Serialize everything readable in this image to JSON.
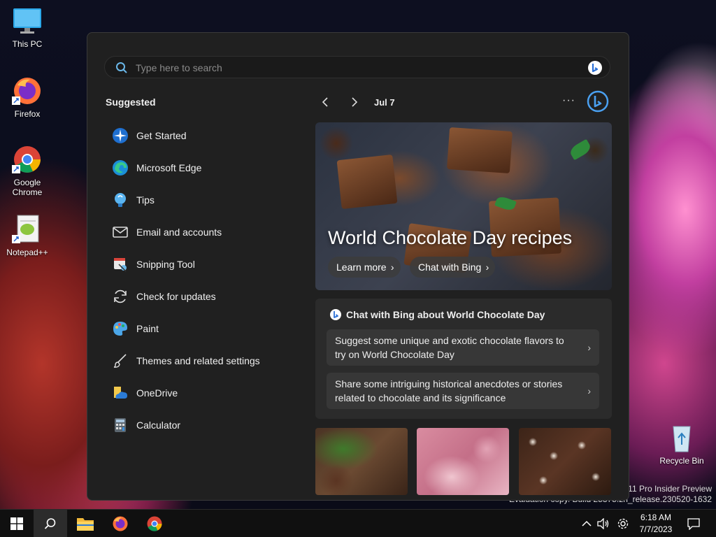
{
  "desktop": {
    "icons": [
      {
        "label": "This PC"
      },
      {
        "label": "Firefox"
      },
      {
        "label": "Google Chrome"
      },
      {
        "label": "Notepad++"
      },
      {
        "label": "Recycle Bin"
      }
    ],
    "watermark": {
      "line1": "s 11 Pro Insider Preview",
      "line2": "Evaluation copy. Build 25375.zn_release.230520-1632"
    }
  },
  "start_menu": {
    "search": {
      "placeholder": "Type here to search"
    },
    "suggested_title": "Suggested",
    "apps": [
      {
        "label": "Get Started",
        "icon": "get-started-icon"
      },
      {
        "label": "Microsoft Edge",
        "icon": "edge-icon"
      },
      {
        "label": "Tips",
        "icon": "tips-icon"
      },
      {
        "label": "Email and accounts",
        "icon": "mail-icon"
      },
      {
        "label": "Snipping Tool",
        "icon": "snipping-tool-icon"
      },
      {
        "label": "Check for updates",
        "icon": "refresh-icon"
      },
      {
        "label": "Paint",
        "icon": "paint-icon"
      },
      {
        "label": "Themes and related settings",
        "icon": "brush-icon"
      },
      {
        "label": "OneDrive",
        "icon": "onedrive-icon"
      },
      {
        "label": "Calculator",
        "icon": "calculator-icon"
      }
    ],
    "feed": {
      "date": "Jul 7",
      "more": "···",
      "hero": {
        "title": "World Chocolate Day recipes",
        "learn_more": "Learn more",
        "chat_with_bing": "Chat with Bing"
      },
      "chat_card": {
        "title": "Chat with Bing about World Chocolate Day",
        "prompts": [
          "Suggest some unique and exotic chocolate flavors to try on World Chocolate Day",
          "Share some intriguing historical anecdotes or stories related to chocolate and its significance"
        ]
      }
    }
  },
  "taskbar": {
    "clock": {
      "time": "6:18 AM",
      "date": "7/7/2023"
    }
  }
}
